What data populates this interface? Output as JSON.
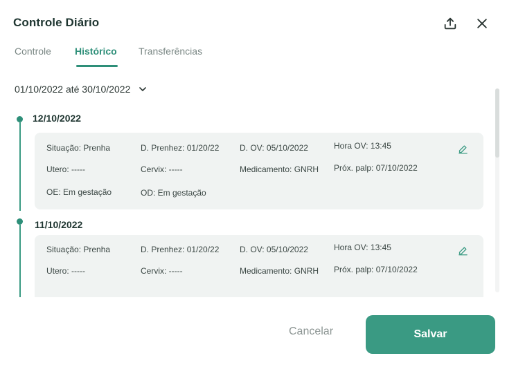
{
  "modal": {
    "title": "Controle Diário",
    "export_icon": "upload-icon",
    "close_icon": "close-icon"
  },
  "tabs": [
    {
      "label": "Controle",
      "active": false
    },
    {
      "label": "Histórico",
      "active": true
    },
    {
      "label": "Transferências",
      "active": false
    }
  ],
  "filter": {
    "date_range": "01/10/2022 até 30/10/2022",
    "icon": "chevron-down-icon"
  },
  "entries": [
    {
      "date": "12/10/2022",
      "fields": {
        "situacao": "Situação: Prenha",
        "d_prenhez": "D. Prenhez: 01/20/22",
        "d_ov": "D. OV: 05/10/2022",
        "hora_ov": "Hora OV: 13:45",
        "utero": "Utero: -----",
        "cervix": "Cervix: -----",
        "medicamento": "Medicamento: GNRH",
        "prox_palp": "Próx. palp: 07/10/2022",
        "oe": "OE: Em gestação",
        "od": "OD: Em gestação"
      }
    },
    {
      "date": "11/10/2022",
      "fields": {
        "situacao": "Situação: Prenha",
        "d_prenhez": "D. Prenhez: 01/20/22",
        "d_ov": "D. OV: 05/10/2022",
        "hora_ov": "Hora OV: 13:45",
        "utero": "Utero: -----",
        "cervix": "Cervix: -----",
        "medicamento": "Medicamento: GNRH",
        "prox_palp": "Próx. palp: 07/10/2022"
      }
    }
  ],
  "footer": {
    "cancel_label": "Cancelar",
    "save_label": "Salvar"
  },
  "colors": {
    "accent": "#3a9a83",
    "card_bg": "#f0f3f2",
    "title": "#1e3530"
  }
}
